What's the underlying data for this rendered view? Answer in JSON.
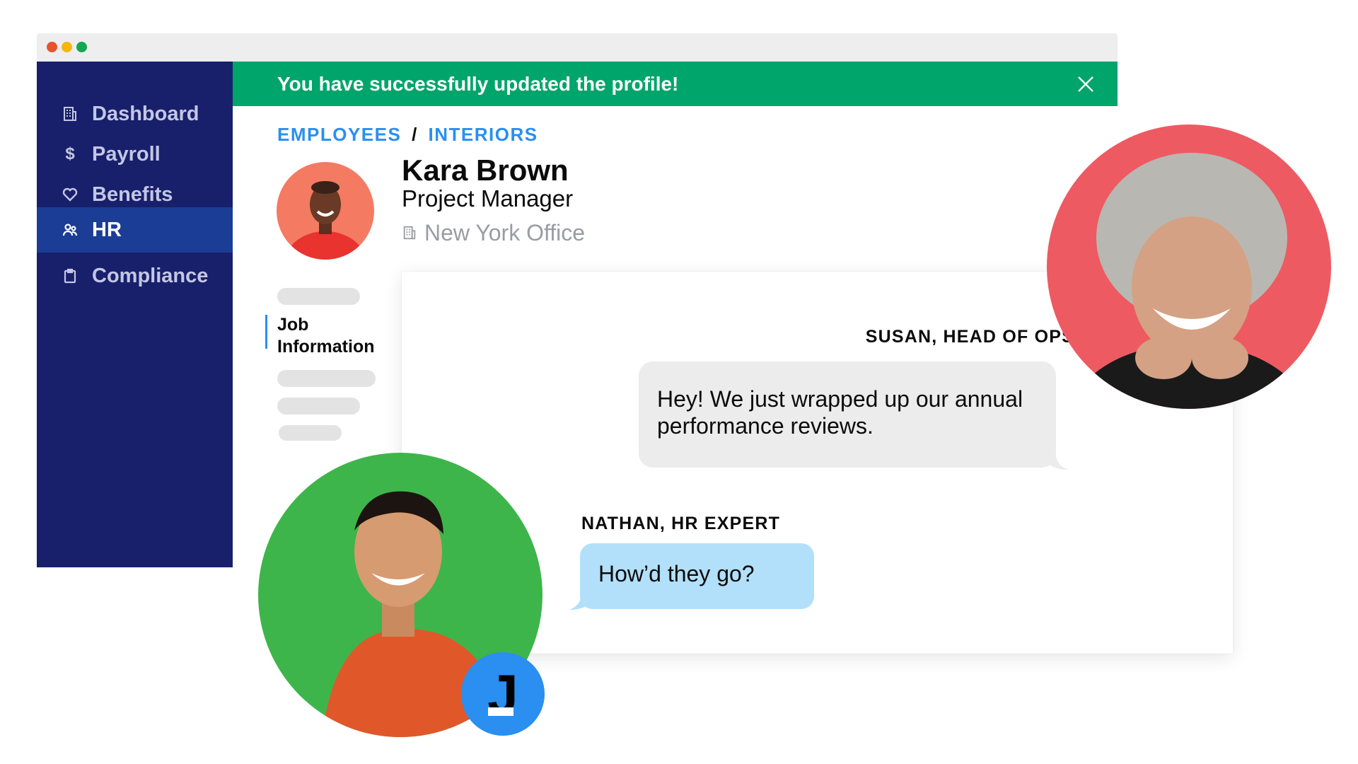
{
  "window": {
    "traffic_lights": [
      "#e8522e",
      "#f5b60e",
      "#11a84f"
    ]
  },
  "sidebar": {
    "items": [
      {
        "label": "Dashboard",
        "icon": "building-icon",
        "active": false
      },
      {
        "label": "Payroll",
        "icon": "dollar-icon",
        "active": false
      },
      {
        "label": "Benefits",
        "icon": "heart-icon",
        "active": false
      },
      {
        "label": "HR",
        "icon": "people-icon",
        "active": true
      },
      {
        "label": "Compliance",
        "icon": "clipboard-icon",
        "active": false
      }
    ]
  },
  "banner": {
    "message": "You have successfully updated the profile!",
    "close_icon": "close-icon"
  },
  "breadcrumb": {
    "root": "EMPLOYEES",
    "separator": "/",
    "current": "INTERIORS"
  },
  "profile": {
    "name": "Kara Brown",
    "role": "Project Manager",
    "office": "New York Office",
    "office_icon": "building-icon"
  },
  "profile_nav": {
    "active_label": "Job Information"
  },
  "chat": {
    "messages": [
      {
        "sender": "SUSAN, HEAD OF OPS",
        "text": "Hey! We just wrapped up our annual performance reviews."
      },
      {
        "sender": "NATHAN, HR EXPERT",
        "text": "How’d they go?"
      }
    ]
  },
  "badge": {
    "letter": "J"
  },
  "colors": {
    "sidebar": "#18206b",
    "sidebar_active": "#1b3d96",
    "banner": "#00a56b",
    "link": "#2a8ff0",
    "bubble_grey": "#ececec",
    "bubble_blue": "#b2e0fb"
  }
}
